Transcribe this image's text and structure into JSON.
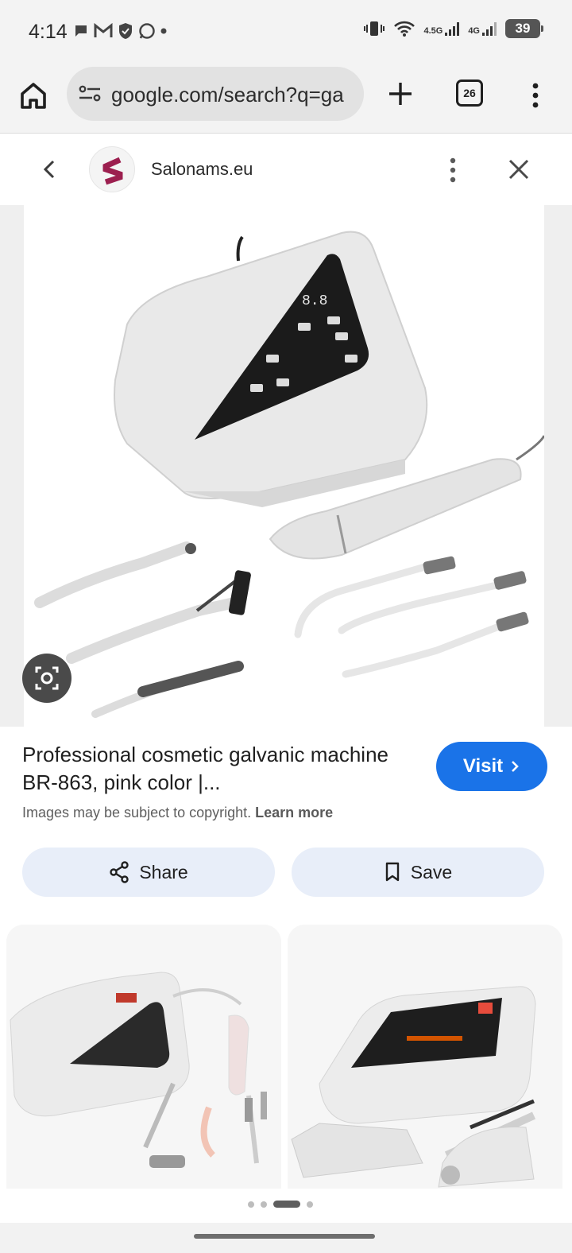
{
  "status_bar": {
    "time": "4:14",
    "network_1": "4.5G",
    "network_2": "4G",
    "battery": "39"
  },
  "browser": {
    "url": "google.com/search?q=ga",
    "tab_count": "26"
  },
  "viewer": {
    "site_name": "Salonams.eu",
    "result_title": "Professional cosmetic galvanic machine BR-863, pink color |...",
    "visit_label": "Visit",
    "copyright_text": "Images may be subject to copyright.",
    "learn_more": "Learn more",
    "share_label": "Share",
    "save_label": "Save"
  },
  "device_display": "8.8",
  "colors": {
    "accent": "#1a73e8",
    "action_bg": "#e8eef9",
    "logo": "#9c1f4f"
  },
  "pagination": {
    "count": 4,
    "active": 2
  }
}
